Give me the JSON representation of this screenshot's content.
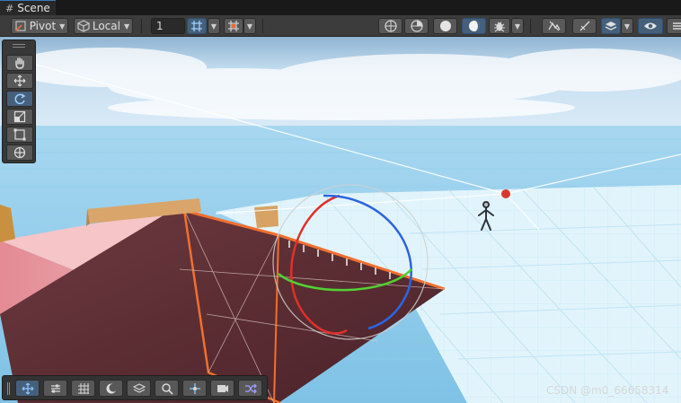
{
  "tab": {
    "title": "Scene",
    "icon": "grid-hash-icon"
  },
  "toolbar": {
    "pivot_label": "Pivot",
    "local_label": "Local",
    "grid_value": "1"
  },
  "tools": [
    "view-hand",
    "move",
    "rotate",
    "scale",
    "rect",
    "transform"
  ],
  "watermark": "CSDN @m0_66658314",
  "colors": {
    "active_blue": "#46607c",
    "sky": "#bcd9ee",
    "ground": "#9fd3ee",
    "platform": "#e3f5fb",
    "red_block": "#e79a9d",
    "ramp": "#5f2f35",
    "gizmo_red": "#e0302a",
    "gizmo_green": "#52d133",
    "gizmo_blue": "#2c64e0"
  }
}
